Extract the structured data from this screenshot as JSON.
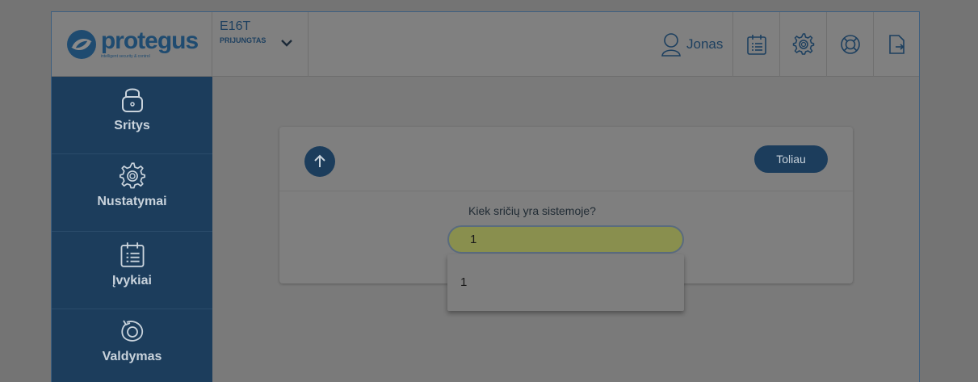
{
  "brand": {
    "name": "protegus",
    "tagline": "intelligent security & control"
  },
  "device": {
    "name": "E16T",
    "status": "PRIJUNGTAS"
  },
  "user": {
    "name": "Jonas"
  },
  "header_icons": [
    "calendar-icon",
    "gear-icon",
    "lifebuoy-icon",
    "logout-icon"
  ],
  "sidebar": {
    "items": [
      {
        "label": "Sritys",
        "icon": "lock-icon"
      },
      {
        "label": "Nustatymai",
        "icon": "gear-icon"
      },
      {
        "label": "Įvykiai",
        "icon": "calendar-icon"
      },
      {
        "label": "Valdymas",
        "icon": "rotate-icon"
      }
    ]
  },
  "wizard": {
    "next_label": "Toliau",
    "question": "Kiek sričių yra sistemoje?",
    "answer_value": "1",
    "options": [
      "1"
    ]
  },
  "colors": {
    "primary": "#1c3d5c",
    "input_fill": "#898f4e"
  }
}
